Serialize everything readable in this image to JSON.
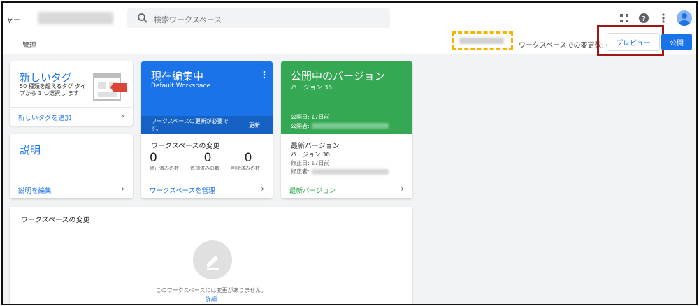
{
  "header": {
    "crumb": "ャー",
    "search_placeholder": "検索ワークスペース",
    "sub_admin": "管理",
    "workspace_changes_label": "ワークスペースでの変更数: 0",
    "preview_label": "プレビュー",
    "publish_label": "公開"
  },
  "new_tag": {
    "title": "新しいタグ",
    "desc": "50 種類を超えるタグ タイプから 1 つ選択し ます",
    "link": "新しいタグを追加"
  },
  "description": {
    "title": "説明",
    "link": "説明を編集"
  },
  "current_edit": {
    "title": "現在編集中",
    "workspace": "Default Workspace",
    "update_notice": "ワークスペースの更新が必要で す。",
    "update_button": "更新",
    "changes_title": "ワークスペースの変更",
    "counts": [
      {
        "value": "0",
        "label": "修正済みの数"
      },
      {
        "value": "0",
        "label": "追加済みの数"
      },
      {
        "value": "0",
        "label": "削除済みの数"
      }
    ],
    "link": "ワークスペースを管理"
  },
  "published": {
    "title": "公開中のバージョン",
    "version": "バージョン 36",
    "published_date": "公開日: 17日前",
    "publisher": "公開者:",
    "latest_title": "最新バージョン",
    "latest_version": "バージョン 36",
    "modified_date": "修正日: 17日前",
    "modifier": "修正者:",
    "link": "最新バージョン"
  },
  "workspace_changes": {
    "title": "ワークスペースの変更",
    "empty_text": "このワークスペースには変更がありません。",
    "detail_link": "詳細"
  },
  "colors": {
    "blue": "#1a73e8",
    "green": "#34a853",
    "red_highlight": "#a01717",
    "yellow_highlight": "#f4b400"
  }
}
